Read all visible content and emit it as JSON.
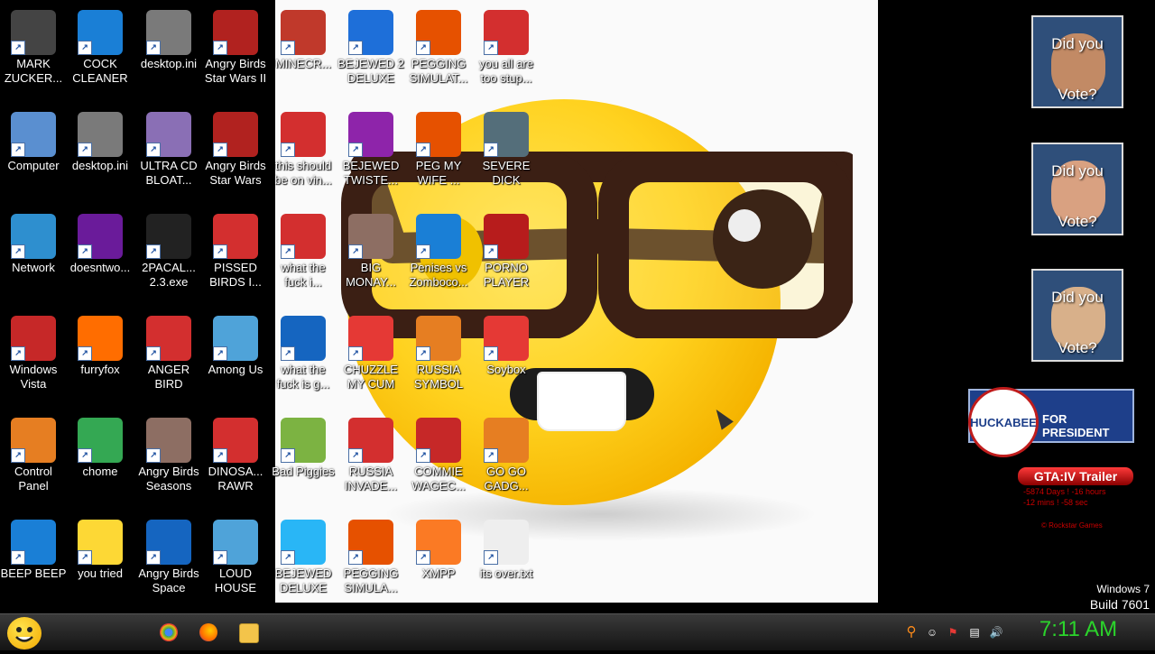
{
  "desktop": {
    "icons": [
      {
        "label": "MARK ZUCKER...",
        "icon": "person-icon",
        "color": "#444444"
      },
      {
        "label": "COCK CLEANER",
        "icon": "blue-card-icon",
        "color": "#1a7fd6"
      },
      {
        "label": "desktop.ini",
        "icon": "gears-file-icon",
        "color": "#7a7a7a"
      },
      {
        "label": "Angry Birds Star Wars II",
        "icon": "angry-birds-icon",
        "color": "#b1221f"
      },
      {
        "label": "MINECR...",
        "icon": "minecraft-icon",
        "color": "#c0392b"
      },
      {
        "label": "BEJEWED 2 DELUXE",
        "icon": "bejeweled-icon",
        "color": "#1e6fd9"
      },
      {
        "label": "PEGGING SIMULAT...",
        "icon": "peggle-icon",
        "color": "#e65100"
      },
      {
        "label": "you all are too stup...",
        "icon": "devcpp-icon",
        "color": "#d32f2f"
      },
      {
        "label": "Computer",
        "icon": "computer-icon",
        "color": "#5a8fd0"
      },
      {
        "label": "desktop.ini",
        "icon": "gears-file-icon",
        "color": "#7a7a7a"
      },
      {
        "label": "ULTRA CD BLOAT...",
        "icon": "cd-icon",
        "color": "#8a6fb5"
      },
      {
        "label": "Angry Birds Star Wars",
        "icon": "angry-birds-icon",
        "color": "#b1221f"
      },
      {
        "label": "this should be on vin...",
        "icon": "angry-birds-icon",
        "color": "#d32f2f"
      },
      {
        "label": "BEJEWED TWISTE...",
        "icon": "bejeweled-icon",
        "color": "#8e24aa"
      },
      {
        "label": "PEG MY WIFE ...",
        "icon": "peggle-icon",
        "color": "#e65100"
      },
      {
        "label": "SEVERE DICK",
        "icon": "gear-sd-icon",
        "color": "#546e7a"
      },
      {
        "label": "Network",
        "icon": "globe-icon",
        "color": "#2e8fcf"
      },
      {
        "label": "doesntwo...",
        "icon": "yahoo-icon",
        "color": "#6a1b9a"
      },
      {
        "label": "2PACAL... 2.3.exe",
        "icon": "console-icon",
        "color": "#222222"
      },
      {
        "label": "PISSED BIRDS I...",
        "icon": "angry-birds-icon",
        "color": "#d32f2f"
      },
      {
        "label": "what the fuck i...",
        "icon": "angry-birds-icon",
        "color": "#d32f2f"
      },
      {
        "label": "BIG MONAY...",
        "icon": "money-bag-icon",
        "color": "#8d6e63"
      },
      {
        "label": "Penises vs Zomboco...",
        "icon": "blue-card-icon",
        "color": "#1a7fd6"
      },
      {
        "label": "PORNO PLAYER",
        "icon": "flash-icon",
        "color": "#b71c1c"
      },
      {
        "label": "Windows Vista",
        "icon": "recycle-bin-icon",
        "color": "#c62828"
      },
      {
        "label": "furryfox",
        "icon": "firefox-icon",
        "color": "#ff6d00"
      },
      {
        "label": "ANGER BIRD",
        "icon": "angry-birds-icon",
        "color": "#d32f2f"
      },
      {
        "label": "Among Us",
        "icon": "among-us-icon",
        "color": "#4fa3d9"
      },
      {
        "label": "what the fuck is g...",
        "icon": "angry-birds-space-icon",
        "color": "#1565c0"
      },
      {
        "label": "CHUZZLE MY CUM",
        "icon": "chuzzle-icon",
        "color": "#e53935"
      },
      {
        "label": "RUSSIA SYMBOL",
        "icon": "blocks-icon",
        "color": "#e67e22"
      },
      {
        "label": "Soybox",
        "icon": "soybox-icon",
        "color": "#e53935"
      },
      {
        "label": "Control Panel",
        "icon": "control-panel-icon",
        "color": "#e67e22"
      },
      {
        "label": "chome",
        "icon": "chrome-icon",
        "color": "#34a853"
      },
      {
        "label": "Angry Birds Seasons",
        "icon": "angry-birds-seasons-icon",
        "color": "#8d6e63"
      },
      {
        "label": "DINOSA... RAWR",
        "icon": "angry-birds-icon",
        "color": "#d32f2f"
      },
      {
        "label": "Bad Piggies",
        "icon": "bad-piggies-icon",
        "color": "#7cb342"
      },
      {
        "label": "RUSSIA INVADE...",
        "icon": "radiation-icon",
        "color": "#d32f2f"
      },
      {
        "label": "COMMIE WAGEC...",
        "icon": "commie-icon",
        "color": "#c62828"
      },
      {
        "label": "GO GO GADG...",
        "icon": "briefcase-icon",
        "color": "#e67e22"
      },
      {
        "label": "BEEP BEEP",
        "icon": "blue-card-icon",
        "color": "#1a7fd6"
      },
      {
        "label": "you tried",
        "icon": "star-icon",
        "color": "#fdd835"
      },
      {
        "label": "Angry Birds Space",
        "icon": "angry-birds-space-icon",
        "color": "#1565c0"
      },
      {
        "label": "LOUD HOUSE",
        "icon": "angry-birds-rio-icon",
        "color": "#4fa3d9"
      },
      {
        "label": "BEJEWED DELUXE",
        "icon": "diamond-icon",
        "color": "#29b6f6"
      },
      {
        "label": "PEGGING SIMULA...",
        "icon": "peggle-icon",
        "color": "#e65100"
      },
      {
        "label": "XMPP",
        "icon": "xampp-icon",
        "color": "#fb7a24"
      },
      {
        "label": "its over.txt",
        "icon": "text-file-icon",
        "color": "#eeeeee"
      }
    ]
  },
  "gadgets": {
    "vote1": {
      "line1": "Did you",
      "line2": "Vote?"
    },
    "vote2": {
      "line1": "Did you",
      "line2": "Vote?"
    },
    "vote3": {
      "line1": "Did you",
      "line2": "Vote?"
    },
    "huckabee": {
      "seal": "HUCKABEE",
      "text": "FOR PRESIDENT"
    },
    "gta": {
      "title": "GTA:IV Trailer",
      "line1": "-5874 Days ! -16 hours",
      "line2": "-12 mins ! -58 sec",
      "credit": "© Rockstar Games"
    }
  },
  "watermark": {
    "line1": "Windows 7",
    "line2": "Build 7601"
  },
  "taskbar": {
    "clock": "7:11 AM",
    "pinned": [
      "chrome-icon",
      "firefox-icon",
      "folder-icon"
    ],
    "tray": [
      "search-icon",
      "smiley-icon",
      "flag-icon",
      "network-icon",
      "volume-icon"
    ]
  }
}
